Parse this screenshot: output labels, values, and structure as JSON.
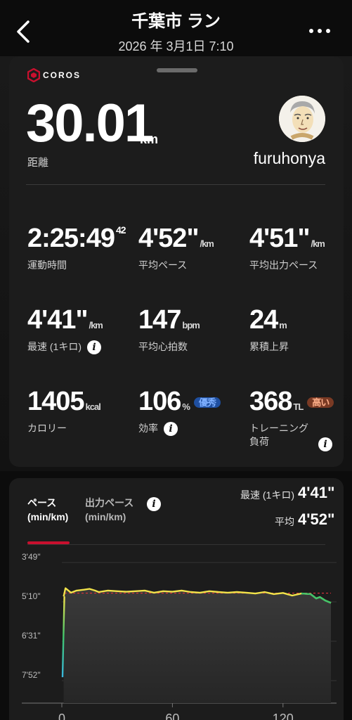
{
  "header": {
    "title": "千葉市 ラン",
    "datetime": "2026 年 3月1日 7:10"
  },
  "brand": {
    "name": "COROS",
    "accent": "#c8102e"
  },
  "summary": {
    "distance_value": "30.01",
    "distance_unit": "km",
    "distance_label": "距離",
    "username": "furuhonya"
  },
  "stats": [
    {
      "value": "2:25:49",
      "sup": "42",
      "unit": "",
      "label": "運動時間"
    },
    {
      "value": "4'52\"",
      "unit": "/km",
      "label": "平均ペース"
    },
    {
      "value": "4'51\"",
      "unit": "/km",
      "label": "平均出力ペース"
    },
    {
      "value": "4'41\"",
      "unit": "/km",
      "label": "最速 (1キロ)",
      "info": true
    },
    {
      "value": "147",
      "unit": "bpm",
      "label": "平均心拍数"
    },
    {
      "value": "24",
      "unit": "m",
      "label": "累積上昇"
    },
    {
      "value": "1405",
      "unit": "kcal",
      "label": "カロリー"
    },
    {
      "value": "106",
      "unit": "%",
      "label": "効率",
      "info": true,
      "badge": "優秀",
      "badge_color": "#1f4fa0",
      "badge_text_color": "#7fb0ff"
    },
    {
      "value": "368",
      "unit": "TL",
      "label": "トレーニング\n負荷",
      "info": true,
      "badge": "高い",
      "badge_color": "#7a3a24",
      "badge_text_color": "#ffb08a"
    }
  ],
  "pace_section": {
    "tab_pace": "ペース\n(min/km)",
    "tab_power": "出力ペース\n(min/km)",
    "fastest_label": "最速 (1キロ)",
    "fastest_value": "4'41\"",
    "avg_label": "平均",
    "avg_value": "4'52\""
  },
  "chart_data": {
    "type": "line",
    "title": "",
    "xlabel": "",
    "ylabel": "",
    "y_inverted": true,
    "y_ticks": [
      "3'49\"",
      "5'10\"",
      "6'31\"",
      "7'52\""
    ],
    "y_tick_values": [
      3.817,
      5.167,
      6.517,
      7.867
    ],
    "x_ticks": [
      0,
      60,
      120
    ],
    "xlim": [
      0,
      146
    ],
    "ylim": [
      3.817,
      7.867
    ],
    "average_line": 4.867,
    "average_color": "#e0303a",
    "series": [
      {
        "x": [
          0,
          1,
          2,
          5,
          8,
          12,
          15,
          18,
          20,
          25,
          30,
          35,
          40,
          45,
          50,
          55,
          60,
          65,
          70,
          75,
          80,
          85,
          90,
          95,
          100,
          105,
          110,
          115,
          120,
          125,
          130,
          135,
          138,
          140,
          143,
          146
        ],
        "y": [
          7.75,
          4.98,
          4.7,
          4.85,
          4.78,
          4.75,
          4.72,
          4.78,
          4.83,
          4.78,
          4.8,
          4.82,
          4.8,
          4.78,
          4.85,
          4.8,
          4.82,
          4.78,
          4.83,
          4.85,
          4.8,
          4.83,
          4.85,
          4.83,
          4.85,
          4.88,
          4.83,
          4.9,
          4.86,
          4.95,
          4.88,
          4.9,
          5.05,
          5.0,
          5.12,
          5.2
        ]
      }
    ]
  }
}
